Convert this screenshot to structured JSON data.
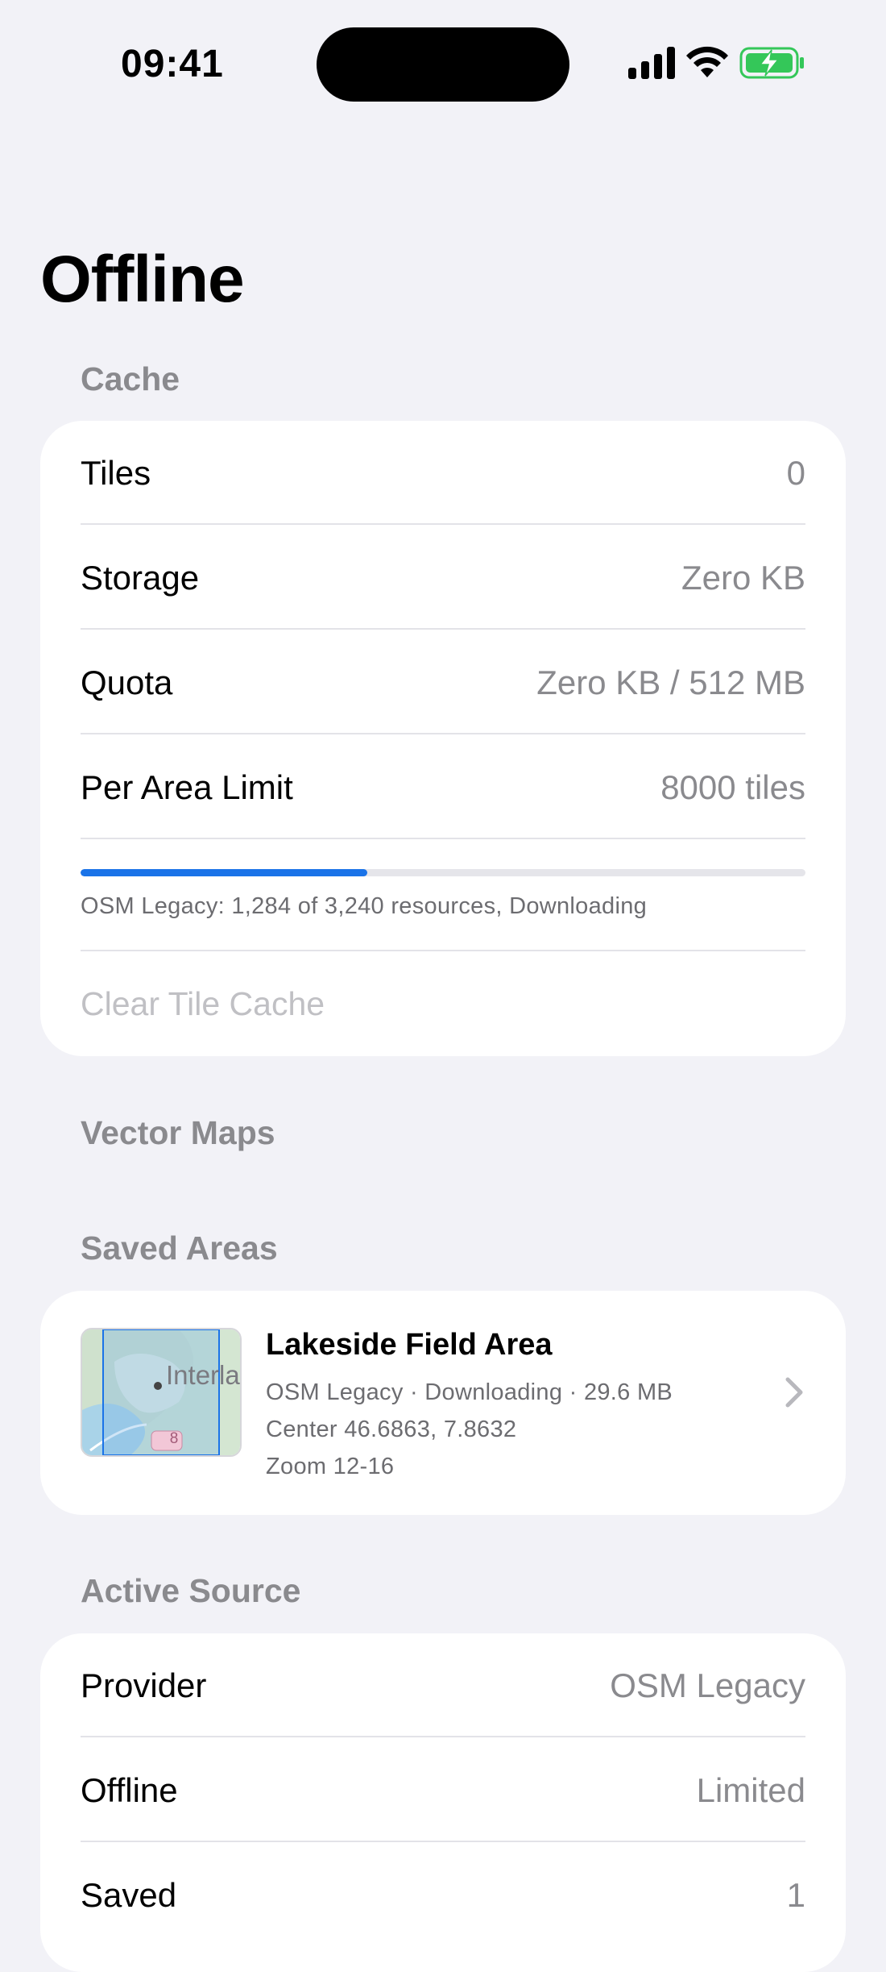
{
  "status": {
    "time": "09:41"
  },
  "page": {
    "title": "Offline"
  },
  "cache": {
    "header": "Cache",
    "rows": [
      {
        "label": "Tiles",
        "value": "0"
      },
      {
        "label": "Storage",
        "value": "Zero KB"
      },
      {
        "label": "Quota",
        "value": "Zero KB / 512 MB"
      },
      {
        "label": "Per Area Limit",
        "value": "8000 tiles"
      }
    ],
    "progress": {
      "fraction": 0.396,
      "text": "OSM Legacy: 1,284 of 3,240 resources, Downloading"
    },
    "clear_label": "Clear Tile Cache"
  },
  "vector_maps": {
    "header": "Vector Maps"
  },
  "saved_areas": {
    "header": "Saved Areas",
    "items": [
      {
        "name": "Lakeside Field Area",
        "meta": "OSM Legacy · Downloading · 29.6 MB",
        "center": "Center 46.6863, 7.8632",
        "zoom": "Zoom 12-16",
        "thumb_label": "Interla",
        "thumb_badge": "8"
      }
    ]
  },
  "active_source": {
    "header": "Active Source",
    "rows": [
      {
        "label": "Provider",
        "value": "OSM Legacy"
      },
      {
        "label": "Offline",
        "value": "Limited"
      },
      {
        "label": "Saved",
        "value": "1"
      }
    ]
  },
  "colors": {
    "accent": "#1a73e8",
    "battery_green": "#34c759",
    "background": "#f2f2f7"
  }
}
